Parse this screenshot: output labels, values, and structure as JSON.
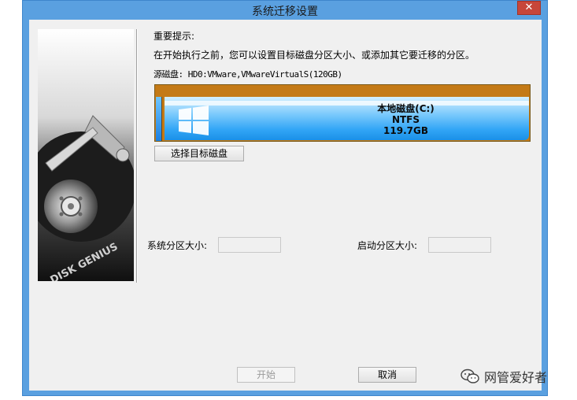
{
  "window": {
    "title": "系统迁移设置",
    "close_glyph": "✕"
  },
  "notice": {
    "title": "重要提示:",
    "text": "在开始执行之前，您可以设置目标磁盘分区大小、或添加其它要迁移的分区。"
  },
  "source": {
    "line": "源磁盘: HD0:VMware,VMwareVirtualS(120GB)"
  },
  "partition": {
    "name": "本地磁盘(C:)",
    "filesystem": "NTFS",
    "size": "119.7GB",
    "icon": "windows-logo-icon"
  },
  "buttons": {
    "select_disk": "选择目标磁盘",
    "start": "开始",
    "cancel": "取消"
  },
  "fields": {
    "system_partition_label": "系统分区大小:",
    "system_partition_value": "",
    "boot_partition_label": "启动分区大小:",
    "boot_partition_value": ""
  },
  "sidebar": {
    "logo_text": "DISK GENIUS"
  },
  "watermark": {
    "text": "网管爱好者",
    "icon": "wechat-icon"
  }
}
